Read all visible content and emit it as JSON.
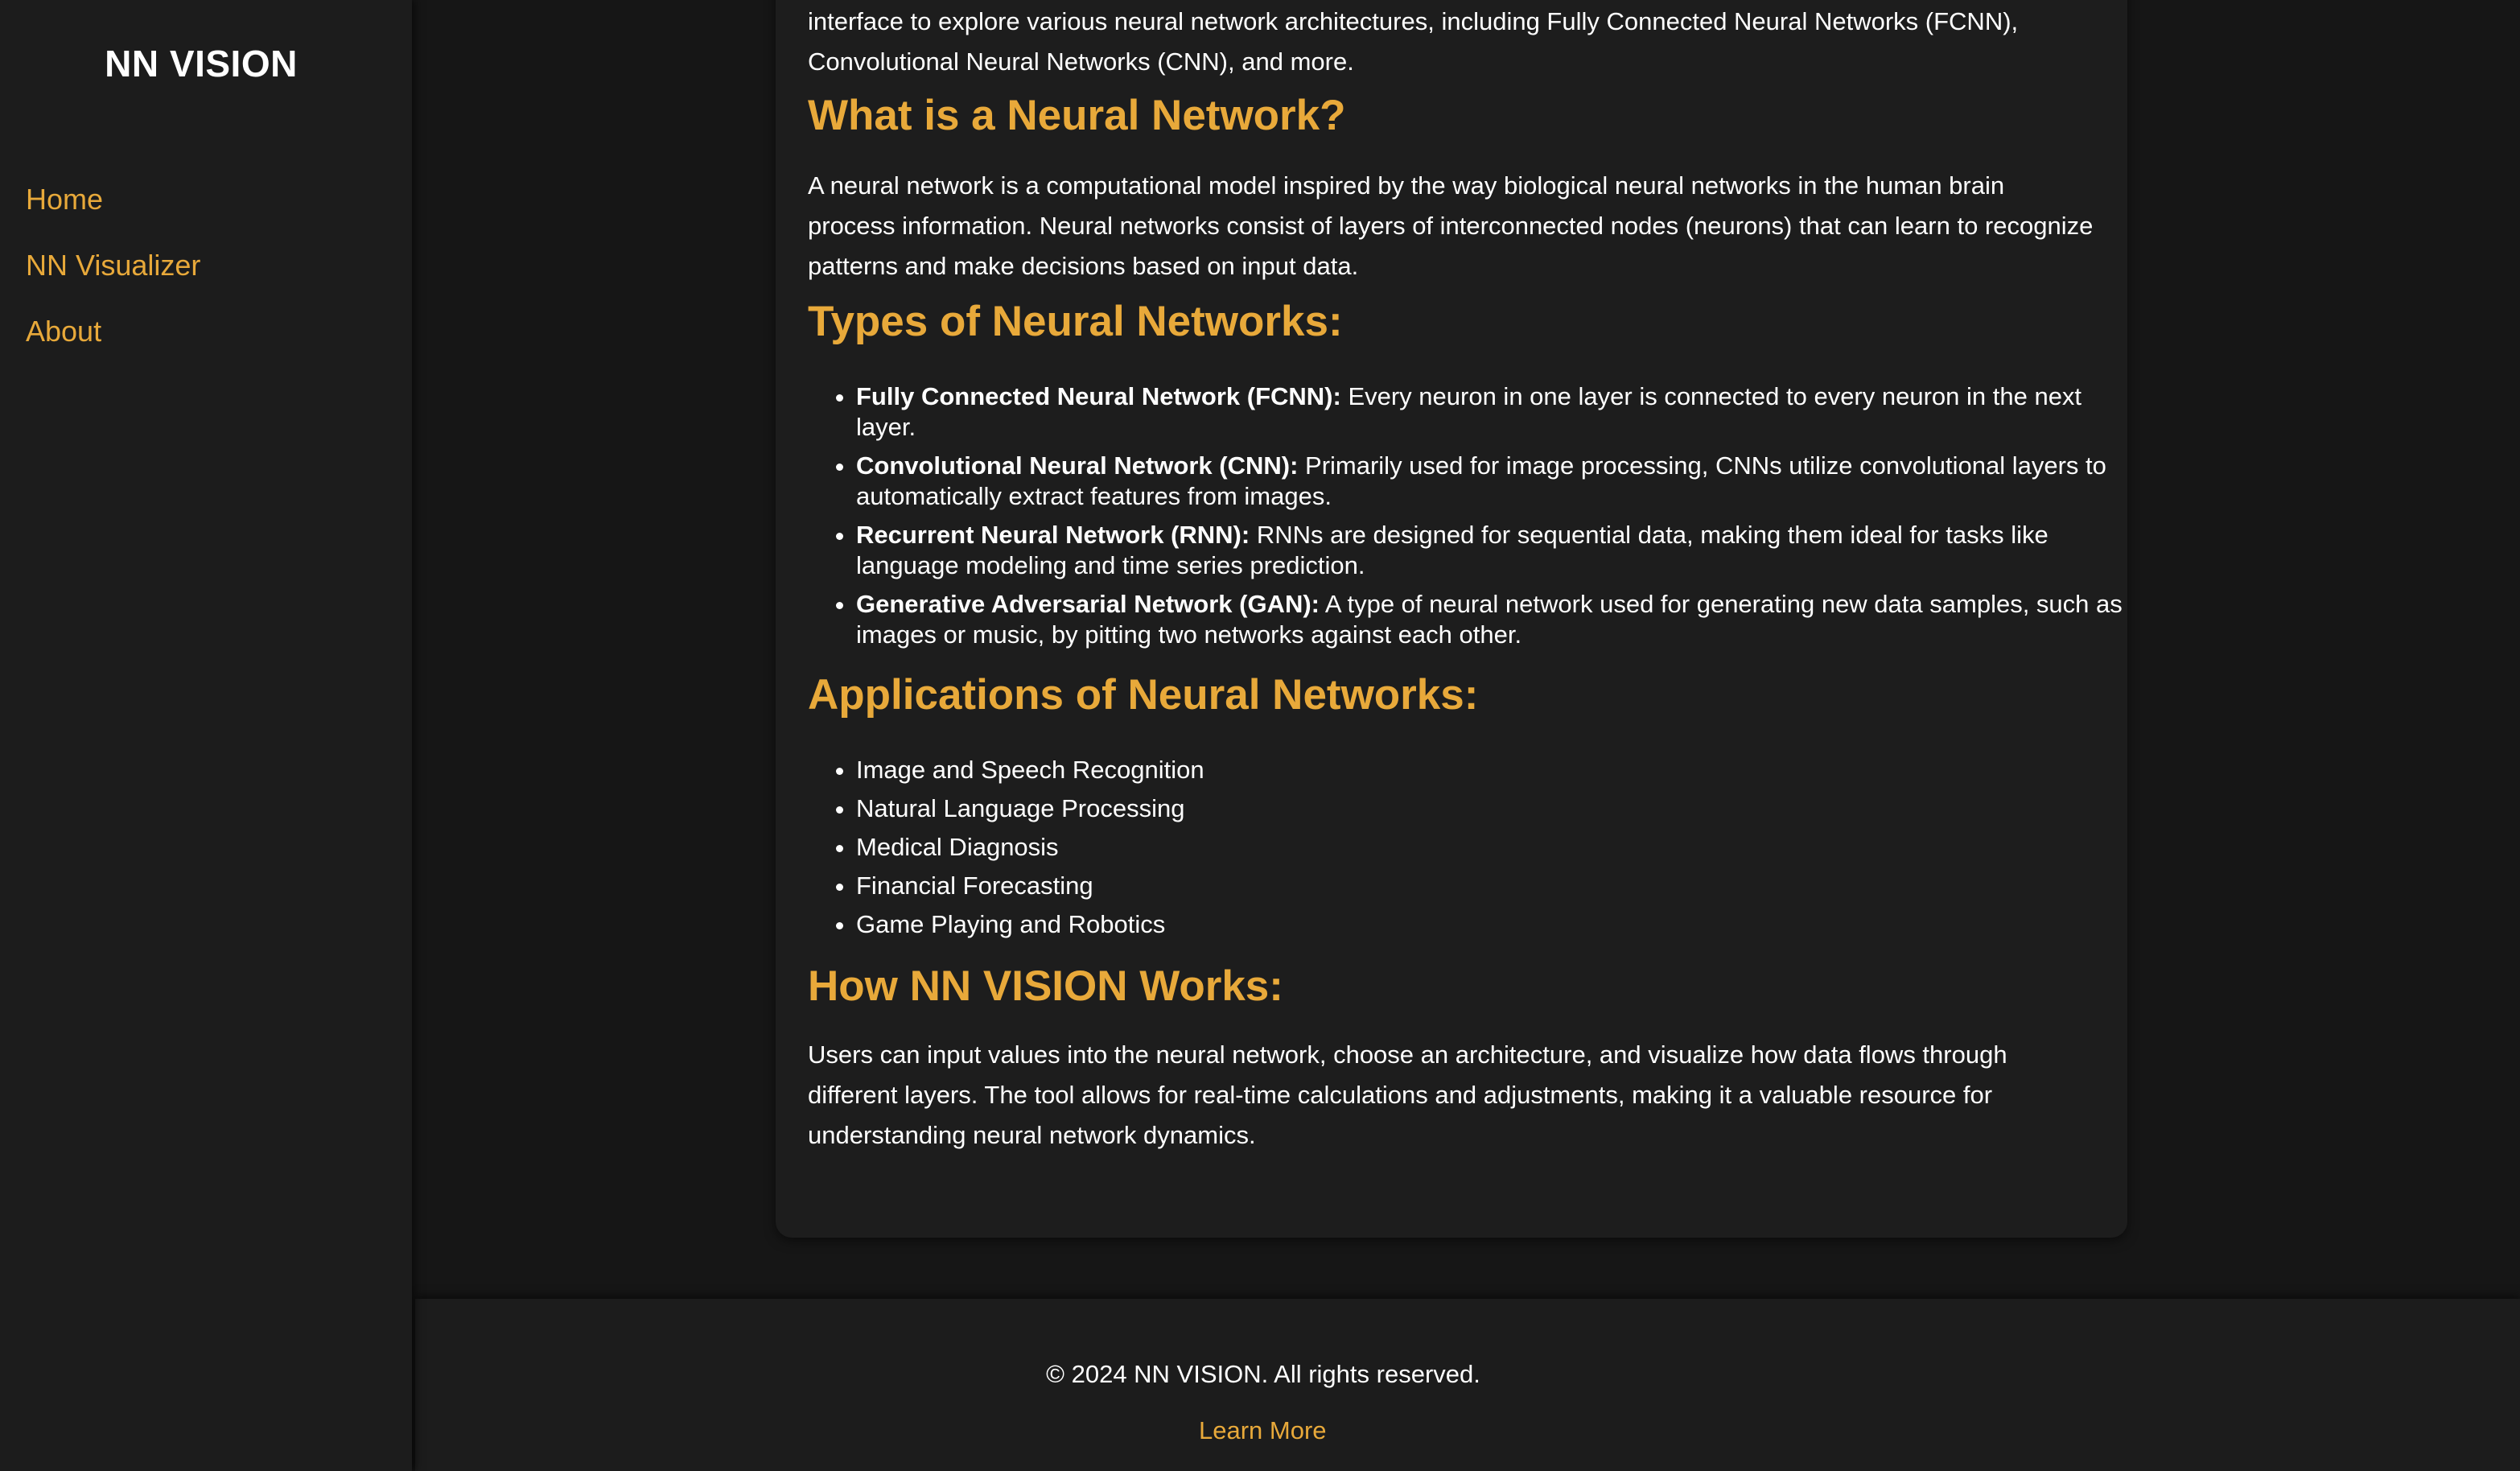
{
  "sidebar": {
    "brand": "NN VISION",
    "nav": [
      {
        "label": "Home"
      },
      {
        "label": "NN Visualizer"
      },
      {
        "label": "About"
      }
    ]
  },
  "content": {
    "intro": "NN VISION is a web-based tool designed to help visualize neural networks in action. It provides an interactive interface to explore various neural network architectures, including Fully Connected Neural Networks (FCNN), Convolutional Neural Networks (CNN), and more.",
    "what_heading": "What is a Neural Network?",
    "what_text": "A neural network is a computational model inspired by the way biological neural networks in the human brain process information. Neural networks consist of layers of interconnected nodes (neurons) that can learn to recognize patterns and make decisions based on input data.",
    "types_heading": "Types of Neural Networks:",
    "types": [
      {
        "term": "Fully Connected Neural Network (FCNN):",
        "desc": " Every neuron in one layer is connected to every neuron in the next layer."
      },
      {
        "term": "Convolutional Neural Network (CNN):",
        "desc": " Primarily used for image processing, CNNs utilize convolutional layers to automatically extract features from images."
      },
      {
        "term": "Recurrent Neural Network (RNN):",
        "desc": " RNNs are designed for sequential data, making them ideal for tasks like language modeling and time series prediction."
      },
      {
        "term": "Generative Adversarial Network (GAN):",
        "desc": " A type of neural network used for generating new data samples, such as images or music, by pitting two networks against each other."
      }
    ],
    "apps_heading": "Applications of Neural Networks:",
    "apps": [
      "Image and Speech Recognition",
      "Natural Language Processing",
      "Medical Diagnosis",
      "Financial Forecasting",
      "Game Playing and Robotics"
    ],
    "how_heading": "How NN VISION Works:",
    "how_text": "Users can input values into the neural network, choose an architecture, and visualize how data flows through different layers. The tool allows for real-time calculations and adjustments, making it a valuable resource for understanding neural network dynamics."
  },
  "footer": {
    "copyright": "© 2024 NN VISION. All rights reserved.",
    "learn_more": "Learn More"
  },
  "colors": {
    "accent": "#e8a93a",
    "background": "#161616",
    "panel": "#1d1d1d",
    "text": "#ffffff"
  }
}
